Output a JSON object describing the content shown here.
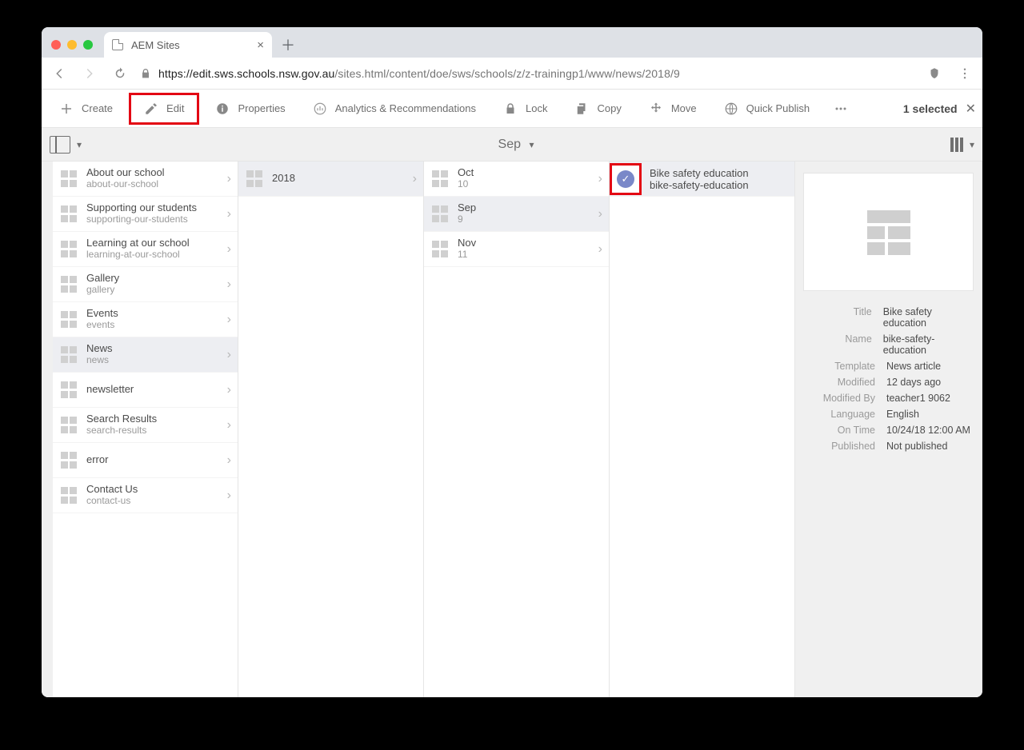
{
  "browser": {
    "tab_title": "AEM Sites",
    "url_origin": "https://edit.sws.schools.nsw.gov.au",
    "url_path": "/sites.html/content/doe/sws/schools/z/z-trainingp1/www/news/2018/9"
  },
  "toolbar": {
    "create": "Create",
    "edit": "Edit",
    "properties": "Properties",
    "analytics": "Analytics & Recommendations",
    "lock": "Lock",
    "copy": "Copy",
    "move": "Move",
    "quick_publish": "Quick Publish",
    "selected_label": "1 selected"
  },
  "rail": {
    "title": "Sep"
  },
  "columns": {
    "c0": [
      {
        "title": "About our school",
        "sub": "about-our-school"
      },
      {
        "title": "Supporting our students",
        "sub": "supporting-our-students"
      },
      {
        "title": "Learning at our school",
        "sub": "learning-at-our-school"
      },
      {
        "title": "Gallery",
        "sub": "gallery"
      },
      {
        "title": "Events",
        "sub": "events"
      },
      {
        "title": "News",
        "sub": "news"
      },
      {
        "title": "newsletter",
        "sub": ""
      },
      {
        "title": "Search Results",
        "sub": "search-results"
      },
      {
        "title": "error",
        "sub": ""
      },
      {
        "title": "Contact Us",
        "sub": "contact-us"
      }
    ],
    "c1": [
      {
        "title": "2018",
        "sub": ""
      }
    ],
    "c2": [
      {
        "title": "Oct",
        "sub": "10"
      },
      {
        "title": "Sep",
        "sub": "9"
      },
      {
        "title": "Nov",
        "sub": "11"
      }
    ],
    "c3": [
      {
        "title": "Bike safety education",
        "sub": "bike-safety-education"
      }
    ]
  },
  "details": {
    "labels": {
      "Title": "Title",
      "Name": "Name",
      "Template": "Template",
      "Modified": "Modified",
      "ModifiedBy": "Modified By",
      "Language": "Language",
      "OnTime": "On Time",
      "Published": "Published"
    },
    "values": {
      "Title": "Bike safety education",
      "Name": "bike-safety-education",
      "Template": "News article",
      "Modified": "12 days ago",
      "ModifiedBy": "teacher1 9062",
      "Language": "English",
      "OnTime": "10/24/18 12:00 AM",
      "Published": "Not published"
    }
  }
}
